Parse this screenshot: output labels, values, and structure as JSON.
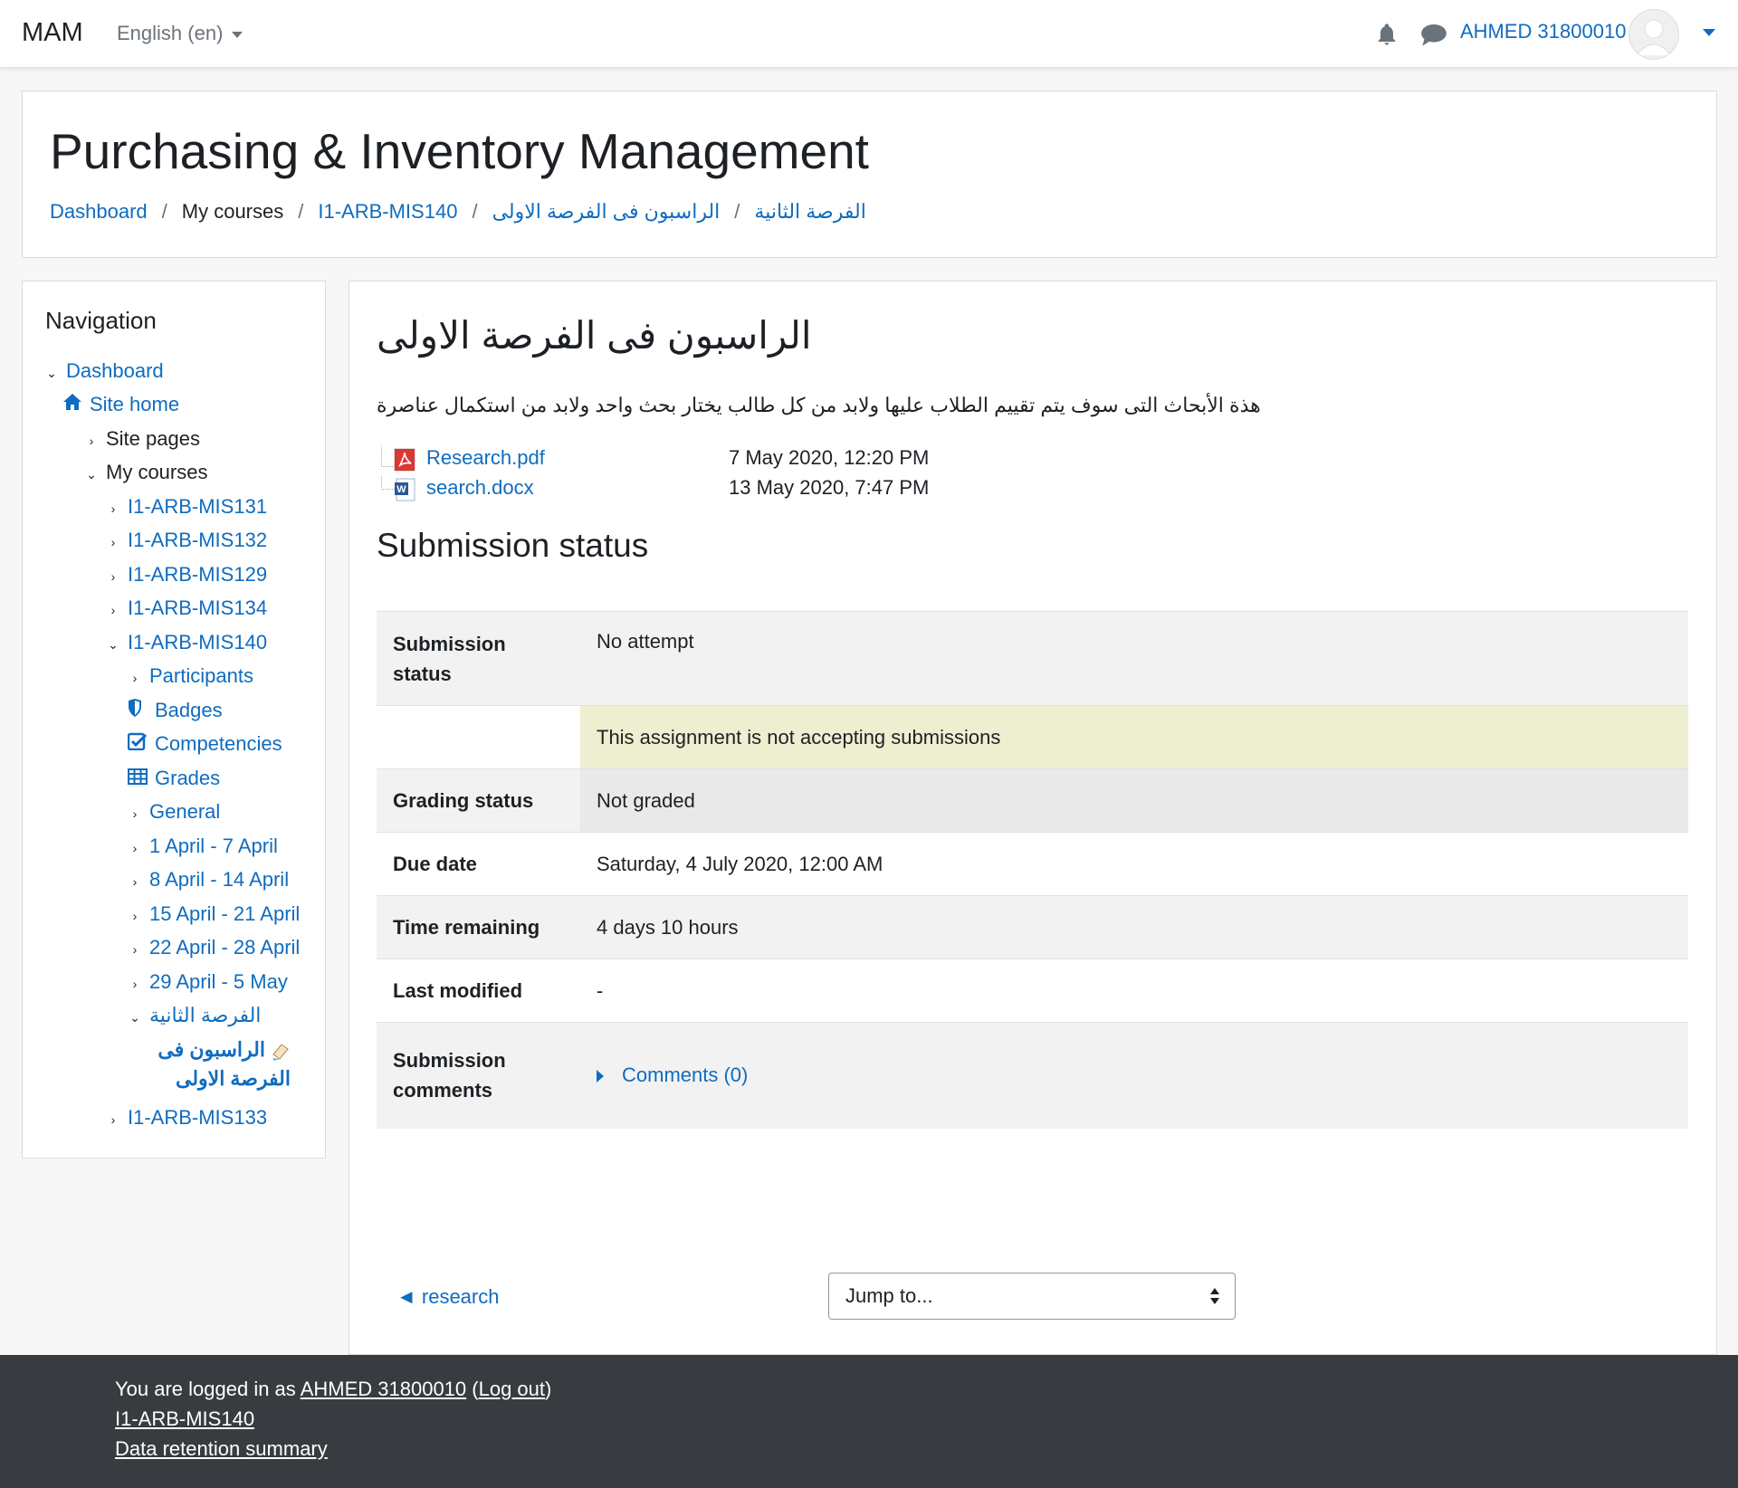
{
  "navbar": {
    "brand": "MAM",
    "language": "English (en)",
    "username": "AHMED 31800010"
  },
  "header": {
    "title": "Purchasing & Inventory Management",
    "breadcrumb": [
      "Dashboard",
      "My courses",
      "I1-ARB-MIS140",
      "الفرصة الثانية",
      "الراسبون فى الفرصة الاولى"
    ]
  },
  "navigation": {
    "title": "Navigation",
    "items": [
      {
        "label": "Dashboard"
      },
      {
        "label": "Site home"
      },
      {
        "label": "Site pages"
      },
      {
        "label": "My courses"
      },
      {
        "label": "I1-ARB-MIS131"
      },
      {
        "label": "I1-ARB-MIS132"
      },
      {
        "label": "I1-ARB-MIS129"
      },
      {
        "label": "I1-ARB-MIS134"
      },
      {
        "label": "I1-ARB-MIS140"
      },
      {
        "label": "Participants"
      },
      {
        "label": "Badges"
      },
      {
        "label": "Competencies"
      },
      {
        "label": "Grades"
      },
      {
        "label": "General"
      },
      {
        "label": "1 April - 7 April"
      },
      {
        "label": "8 April - 14 April"
      },
      {
        "label": "15 April - 21 April"
      },
      {
        "label": "22 April - 28 April"
      },
      {
        "label": "29 April - 5 May"
      },
      {
        "label": "الفرصة الثانية"
      },
      {
        "label": "الراسبون فى الفرصة الاولى"
      },
      {
        "label": "I1-ARB-MIS133"
      }
    ]
  },
  "activity": {
    "title": "الراسبون فى الفرصة الاولى",
    "intro": "هذة الأبحاث التى سوف يتم تقييم الطلاب عليها ولابد من كل طالب يختار بحث واحد ولابد من استكمال عناصرة",
    "files": [
      {
        "name": "Research.pdf",
        "date": "7 May 2020, 12:20 PM",
        "icon": "pdf-icon"
      },
      {
        "name": "search.docx",
        "date": "13 May 2020, 7:47 PM",
        "icon": "word-icon"
      }
    ],
    "submission_heading": "Submission status",
    "status_rows": {
      "submission_status_label": "Submission status",
      "submission_status_value": "No attempt",
      "notice": "This assignment is not accepting submissions",
      "grading_label": "Grading status",
      "grading_value": "Not graded",
      "due_label": "Due date",
      "due_value": "Saturday, 4 July 2020, 12:00 AM",
      "remaining_label": "Time remaining",
      "remaining_value": "4 days 10 hours",
      "modified_label": "Last modified",
      "modified_value": "-",
      "comments_label": "Submission comments",
      "comments_link": "Comments (0)"
    },
    "prev_link": "◄ research",
    "jump_placeholder": "Jump to..."
  },
  "footer": {
    "logged_in_prefix": "You are logged in as ",
    "user": "AHMED 31800010",
    "open_paren": " (",
    "logout": "Log out",
    "close_paren": ")",
    "course": "I1-ARB-MIS140",
    "retention": "Data retention summary"
  },
  "colors": {
    "link": "#0f6cbf",
    "notice_bg": "#eeeed0",
    "footer_bg": "#383c40"
  }
}
